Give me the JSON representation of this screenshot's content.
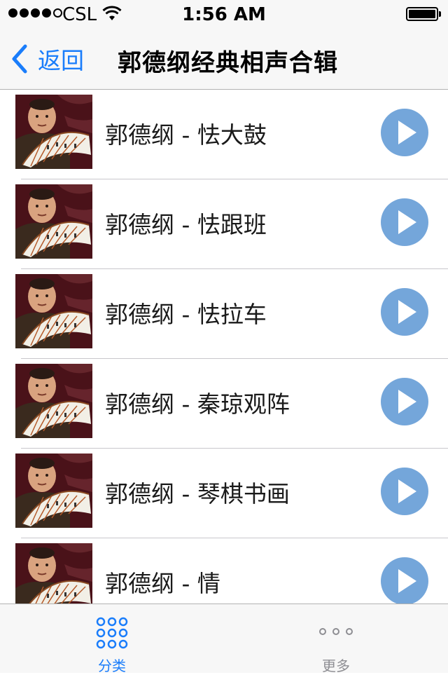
{
  "status_bar": {
    "carrier": "CSL",
    "time": "1:56 AM",
    "signal_bars": 4,
    "signal_max": 5,
    "battery_level": 1.0
  },
  "nav": {
    "back_label": "返回",
    "title": "郭德纲经典相声合辑"
  },
  "list": {
    "items": [
      {
        "title": "郭德纲 - 怯大鼓"
      },
      {
        "title": "郭德纲 - 怯跟班"
      },
      {
        "title": "郭德纲 - 怯拉车"
      },
      {
        "title": "郭德纲 - 秦琼观阵"
      },
      {
        "title": "郭德纲 - 琴棋书画"
      },
      {
        "title": "郭德纲 - 情"
      }
    ]
  },
  "tabs": [
    {
      "label": "分类",
      "icon": "grid-icon",
      "active": true
    },
    {
      "label": "更多",
      "icon": "more-icon",
      "active": false
    }
  ],
  "colors": {
    "accent": "#1a7dfb",
    "play_button": "#74a6da",
    "bar_background": "#f7f7f7"
  }
}
